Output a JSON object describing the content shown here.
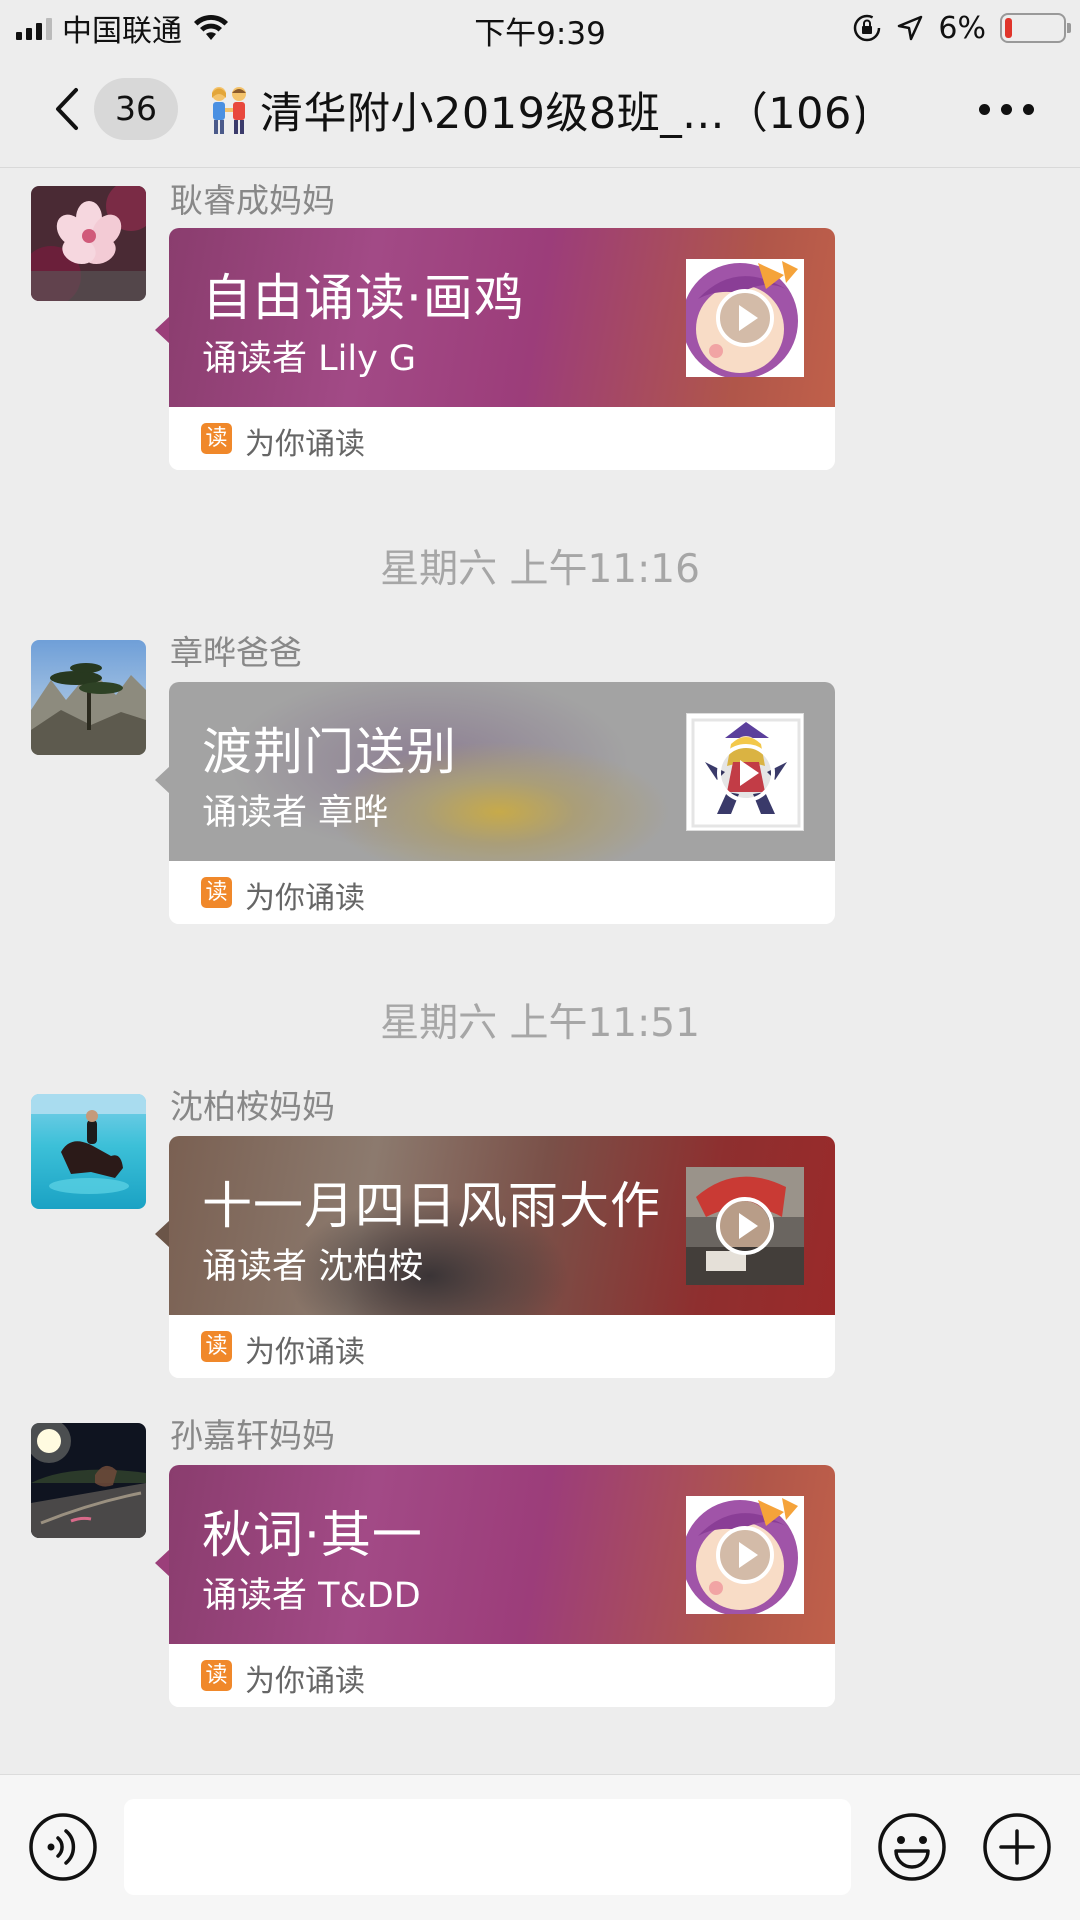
{
  "status_bar": {
    "carrier": "中国联通",
    "time": "下午9:39",
    "battery_percent": "6%",
    "battery_level": 0.06,
    "icons": [
      "signal-icon",
      "wifi-icon",
      "rotation-lock-icon",
      "location-arrow-icon",
      "battery-icon"
    ]
  },
  "nav": {
    "back_icon": "chevron-left-icon",
    "unread_count": "36",
    "title_icon": "couple-emoji-icon",
    "title": "清华附小2019级8班_...（106)",
    "mute_icon": "bell-slash-icon",
    "more_icon": "more-dots-icon"
  },
  "messages": [
    {
      "sender": "耿睿成妈妈",
      "title": "自由诵读·画鸡",
      "reader": "诵读者 Lily G",
      "source_icon": "读",
      "source": "为你诵读",
      "avatar": "flower-photo",
      "theme_color": "#9b3f7a"
    },
    {
      "time_separator": "星期六 上午11:16",
      "sender": "章晔爸爸",
      "title": "渡荆门送别",
      "reader": "诵读者 章晔",
      "source_icon": "读",
      "source": "为你诵读",
      "avatar": "mountain-pine-photo",
      "theme_color": "#a3a3a3"
    },
    {
      "time_separator": "星期六 上午11:51",
      "sender": "沈柏桉妈妈",
      "title": "十一月四日风雨大作",
      "reader": "诵读者 沈柏桉",
      "source_icon": "读",
      "source": "为你诵读",
      "avatar": "horse-in-sea-photo",
      "theme_color": "#8a3a34"
    },
    {
      "sender": "孙嘉轩妈妈",
      "title": "秋词·其一",
      "reader": "诵读者 T&DD",
      "source_icon": "读",
      "source": "为你诵读",
      "avatar": "night-road-photo",
      "theme_color": "#9b3f7a"
    }
  ],
  "input_bar": {
    "voice_icon": "voice-icon",
    "text_value": "",
    "emoji_icon": "smiley-icon",
    "plus_icon": "plus-circle-icon"
  }
}
